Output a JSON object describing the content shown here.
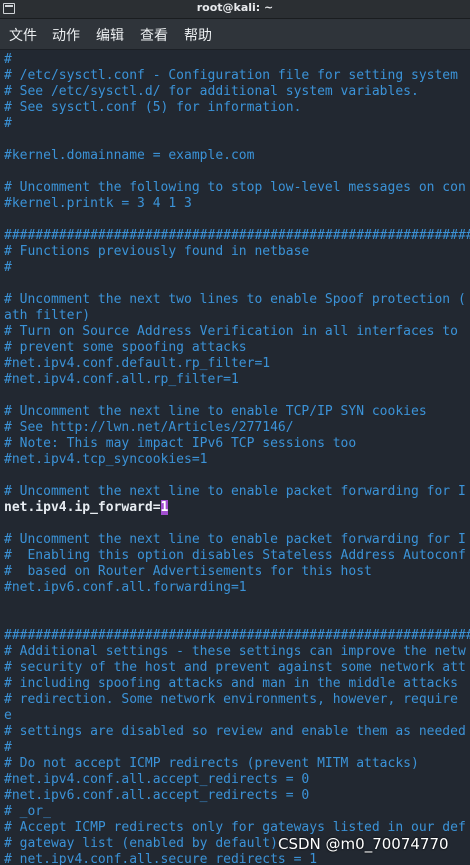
{
  "window": {
    "title": "root@kali: ~"
  },
  "menu": {
    "items": [
      {
        "label": "文件"
      },
      {
        "label": "动作"
      },
      {
        "label": "编辑"
      },
      {
        "label": "查看"
      },
      {
        "label": "帮助"
      }
    ]
  },
  "editor": {
    "lines": [
      "#",
      "# /etc/sysctl.conf - Configuration file for setting system",
      "# See /etc/sysctl.d/ for additional system variables.",
      "# See sysctl.conf (5) for information.",
      "#",
      "",
      "#kernel.domainname = example.com",
      "",
      "# Uncomment the following to stop low-level messages on con",
      "#kernel.printk = 3 4 1 3",
      "",
      "##############################################################",
      "# Functions previously found in netbase",
      "#",
      "",
      "# Uncomment the next two lines to enable Spoof protection (",
      "ath filter)",
      "# Turn on Source Address Verification in all interfaces to",
      "# prevent some spoofing attacks",
      "#net.ipv4.conf.default.rp_filter=1",
      "#net.ipv4.conf.all.rp_filter=1",
      "",
      "# Uncomment the next line to enable TCP/IP SYN cookies",
      "# See http://lwn.net/Articles/277146/",
      "# Note: This may impact IPv6 TCP sessions too",
      "#net.ipv4.tcp_syncookies=1",
      "",
      "# Uncomment the next line to enable packet forwarding for I",
      "",
      "",
      "# Uncomment the next line to enable packet forwarding for I",
      "#  Enabling this option disables Stateless Address Autoconf",
      "#  based on Router Advertisements for this host",
      "#net.ipv6.conf.all.forwarding=1",
      "",
      "",
      "##############################################################",
      "# Additional settings - these settings can improve the netw",
      "# security of the host and prevent against some network att",
      "# including spoofing attacks and man in the middle attacks",
      "# redirection. Some network environments, however, require",
      "e",
      "# settings are disabled so review and enable them as needed",
      "#",
      "# Do not accept ICMP redirects (prevent MITM attacks)",
      "#net.ipv4.conf.all.accept_redirects = 0",
      "#net.ipv6.conf.all.accept_redirects = 0",
      "# _or_",
      "# Accept ICMP redirects only for gateways listed in our def",
      "# gateway list (enabled by default)",
      "# net.ipv4.conf.all.secure_redirects = 1"
    ],
    "active_line": {
      "index": 28,
      "text_before_cursor": "net.ipv4.ip_forward=",
      "cursor_char": "1"
    }
  },
  "watermark": "CSDN @m0_70074770",
  "colors": {
    "background": "#222831",
    "comment": "#3b93d8",
    "plain_text": "#e8edf2",
    "cursor": "#a24fd0"
  }
}
